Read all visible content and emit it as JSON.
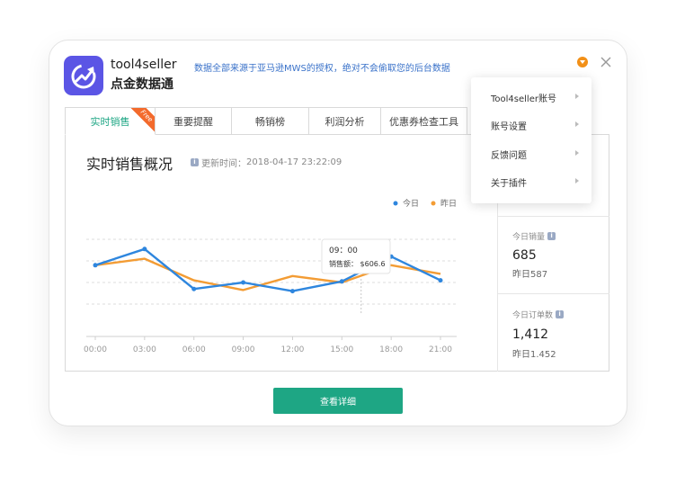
{
  "header": {
    "brand_name": "tool4seller",
    "brand_sub": "点金数据通",
    "notice": "数据全部来源于亚马逊MWS的授权，绝对不会偷取您的后台数据"
  },
  "tabs": [
    {
      "label": "实时销售",
      "badge": "Free"
    },
    {
      "label": "重要提醒"
    },
    {
      "label": "畅销榜"
    },
    {
      "label": "利润分析"
    },
    {
      "label": "优惠券检查工具"
    }
  ],
  "section": {
    "title": "实时销售概况",
    "update_prefix": "更新时间：",
    "update_time": "2018-04-17 23:22:09"
  },
  "stats": {
    "sales_label": "今日销量",
    "sales_value": "685",
    "sales_prev": "昨日587",
    "orders_label": "今日订单数",
    "orders_value": "1,412",
    "orders_prev": "昨日1.452"
  },
  "menu": {
    "items": [
      "Tool4seller账号",
      "账号设置",
      "反馈问题",
      "关于插件"
    ]
  },
  "tooltip": {
    "time": "09：00",
    "label": "销售额：",
    "value": "$606.6"
  },
  "button": {
    "details_label": "查看详细"
  },
  "colors": {
    "accent": "#1ea684",
    "today": "#2e86de",
    "yesterday": "#f39c34",
    "brand": "#5b55e5",
    "ribbon": "#f36a2c"
  },
  "chart_data": {
    "type": "line",
    "categories": [
      "00:00",
      "03:00",
      "06:00",
      "09:00",
      "12:00",
      "15:00",
      "18:00",
      "21:00"
    ],
    "x": [
      0,
      1.5,
      3,
      4.5,
      6,
      7.5,
      9,
      10.5,
      12,
      13.5,
      15,
      16.5,
      18,
      19.5,
      21
    ],
    "series": [
      {
        "name": "今日",
        "color": "#2e86de",
        "values": [
          6.6,
          8.1,
          4.4,
          5.0,
          4.2,
          5.1,
          7.4,
          5.2
        ]
      },
      {
        "name": "昨日",
        "color": "#f39c34",
        "values": [
          6.6,
          7.2,
          5.2,
          4.3,
          5.6,
          5.0,
          6.6,
          5.8
        ]
      }
    ],
    "ylim": [
      0,
      10
    ],
    "grid": true,
    "legend": "top-right"
  }
}
